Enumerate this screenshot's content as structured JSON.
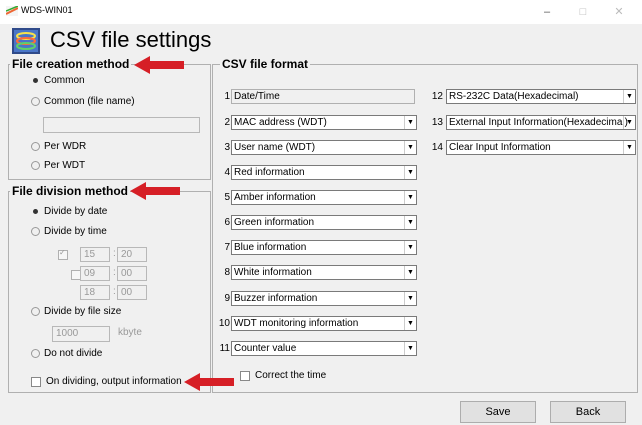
{
  "window": {
    "title": "WDS-WIN01",
    "minimize": "–",
    "maximize": "□",
    "close": "✕"
  },
  "page_title": "CSV file settings",
  "file_creation": {
    "label": "File creation method",
    "options": [
      "Common",
      "Common (file name)",
      "Per WDR",
      "Per WDT"
    ],
    "file_name_value": ""
  },
  "file_division": {
    "label": "File division method",
    "by_date": "Divide by date",
    "by_time": "Divide by time",
    "times": [
      {
        "h": "15",
        "m": "20"
      },
      {
        "h": "09",
        "m": "00"
      },
      {
        "h": "18",
        "m": "00"
      }
    ],
    "time_sep": ":",
    "by_size": "Divide by file size",
    "size_value": "1000",
    "size_unit": "kbyte",
    "no_divide": "Do not divide",
    "output_info": "On dividing, output information"
  },
  "csv_format": {
    "label": "CSV file format",
    "fields": [
      {
        "num": "1",
        "value": "Date/Time"
      },
      {
        "num": "2",
        "value": "MAC address (WDT)"
      },
      {
        "num": "3",
        "value": "User name (WDT)"
      },
      {
        "num": "4",
        "value": "Red information"
      },
      {
        "num": "5",
        "value": "Amber information"
      },
      {
        "num": "6",
        "value": "Green information"
      },
      {
        "num": "7",
        "value": "Blue information"
      },
      {
        "num": "8",
        "value": "White information"
      },
      {
        "num": "9",
        "value": "Buzzer information"
      },
      {
        "num": "10",
        "value": "WDT monitoring information"
      },
      {
        "num": "11",
        "value": "Counter value"
      },
      {
        "num": "12",
        "value": "RS-232C Data(Hexadecimal)"
      },
      {
        "num": "13",
        "value": "External Input Information(Hexadecimal)"
      },
      {
        "num": "14",
        "value": "Clear Input Information"
      }
    ],
    "correct_time": "Correct the time"
  },
  "buttons": {
    "save": "Save",
    "back": "Back"
  },
  "colors": {
    "annotation_arrow": "#d61f26"
  }
}
